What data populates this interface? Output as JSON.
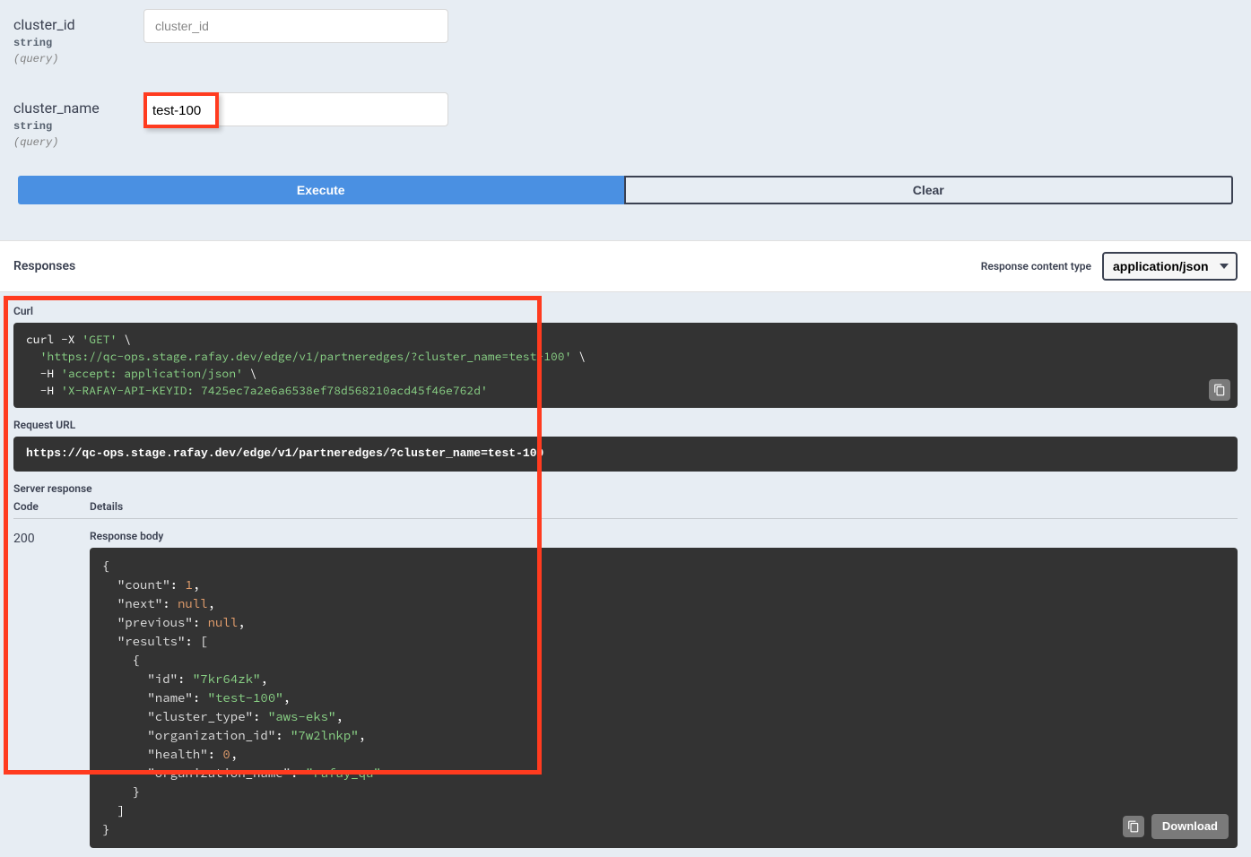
{
  "params": {
    "cluster_id": {
      "name": "cluster_id",
      "type": "string",
      "in": "(query)",
      "placeholder": "cluster_id",
      "value": ""
    },
    "cluster_name": {
      "name": "cluster_name",
      "type": "string",
      "in": "(query)",
      "placeholder": "cluster_name",
      "value": "test-100"
    }
  },
  "buttons": {
    "execute": "Execute",
    "clear": "Clear",
    "download": "Download"
  },
  "responses": {
    "title": "Responses",
    "content_type_label": "Response content type",
    "content_type_value": "application/json"
  },
  "curl": {
    "label": "Curl",
    "line1_a": "curl -X ",
    "line1_b": "'GET'",
    "line1_c": " \\",
    "line2_a": "  ",
    "line2_b": "'https://qc-ops.stage.rafay.dev/edge/v1/partneredges/?cluster_name=test-100'",
    "line2_c": " \\",
    "line3_a": "  -H ",
    "line3_b": "'accept: application/json'",
    "line3_c": " \\",
    "line4_a": "  -H ",
    "line4_b": "'X-RAFAY-API-KEYID: 7425ec7a2e6a6538ef78d568210acd45f46e762d'"
  },
  "request_url": {
    "label": "Request URL",
    "value": "https://qc-ops.stage.rafay.dev/edge/v1/partneredges/?cluster_name=test-100"
  },
  "server_response": {
    "label": "Server response",
    "code_header": "Code",
    "details_header": "Details",
    "status_code": "200",
    "body_label": "Response body"
  },
  "body_lines": [
    [
      {
        "t": "sym",
        "v": "{"
      }
    ],
    [
      {
        "t": "sym",
        "v": "  "
      },
      {
        "t": "key",
        "v": "\"count\""
      },
      {
        "t": "sym",
        "v": ": "
      },
      {
        "t": "num",
        "v": "1"
      },
      {
        "t": "sym",
        "v": ","
      }
    ],
    [
      {
        "t": "sym",
        "v": "  "
      },
      {
        "t": "key",
        "v": "\"next\""
      },
      {
        "t": "sym",
        "v": ": "
      },
      {
        "t": "null",
        "v": "null"
      },
      {
        "t": "sym",
        "v": ","
      }
    ],
    [
      {
        "t": "sym",
        "v": "  "
      },
      {
        "t": "key",
        "v": "\"previous\""
      },
      {
        "t": "sym",
        "v": ": "
      },
      {
        "t": "null",
        "v": "null"
      },
      {
        "t": "sym",
        "v": ","
      }
    ],
    [
      {
        "t": "sym",
        "v": "  "
      },
      {
        "t": "key",
        "v": "\"results\""
      },
      {
        "t": "sym",
        "v": ": ["
      }
    ],
    [
      {
        "t": "sym",
        "v": "    {"
      }
    ],
    [
      {
        "t": "sym",
        "v": "      "
      },
      {
        "t": "key",
        "v": "\"id\""
      },
      {
        "t": "sym",
        "v": ": "
      },
      {
        "t": "strv",
        "v": "\"7kr64zk\""
      },
      {
        "t": "sym",
        "v": ","
      }
    ],
    [
      {
        "t": "sym",
        "v": "      "
      },
      {
        "t": "key",
        "v": "\"name\""
      },
      {
        "t": "sym",
        "v": ": "
      },
      {
        "t": "strv",
        "v": "\"test-100\""
      },
      {
        "t": "sym",
        "v": ","
      }
    ],
    [
      {
        "t": "sym",
        "v": "      "
      },
      {
        "t": "key",
        "v": "\"cluster_type\""
      },
      {
        "t": "sym",
        "v": ": "
      },
      {
        "t": "strv",
        "v": "\"aws-eks\""
      },
      {
        "t": "sym",
        "v": ","
      }
    ],
    [
      {
        "t": "sym",
        "v": "      "
      },
      {
        "t": "key",
        "v": "\"organization_id\""
      },
      {
        "t": "sym",
        "v": ": "
      },
      {
        "t": "strv",
        "v": "\"7w2lnkp\""
      },
      {
        "t": "sym",
        "v": ","
      }
    ],
    [
      {
        "t": "sym",
        "v": "      "
      },
      {
        "t": "key",
        "v": "\"health\""
      },
      {
        "t": "sym",
        "v": ": "
      },
      {
        "t": "num",
        "v": "0"
      },
      {
        "t": "sym",
        "v": ","
      }
    ],
    [
      {
        "t": "sym",
        "v": "      "
      },
      {
        "t": "key",
        "v": "\"organization_name\""
      },
      {
        "t": "sym",
        "v": ": "
      },
      {
        "t": "strv",
        "v": "\"rafay_qa\""
      }
    ],
    [
      {
        "t": "sym",
        "v": "    }"
      }
    ],
    [
      {
        "t": "sym",
        "v": "  ]"
      }
    ],
    [
      {
        "t": "sym",
        "v": "}"
      }
    ]
  ]
}
